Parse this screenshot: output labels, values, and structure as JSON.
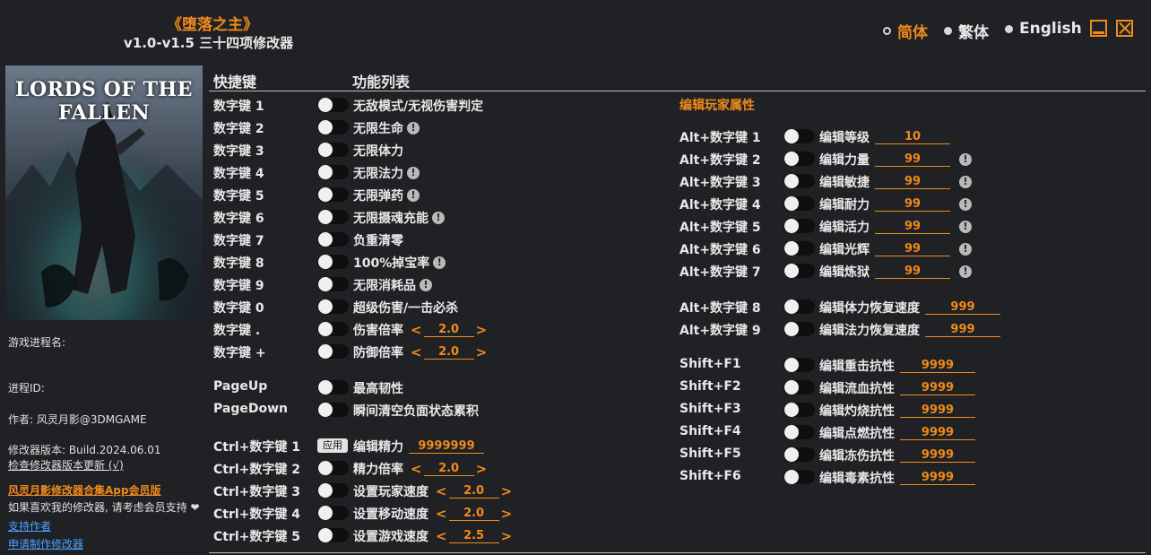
{
  "header": {
    "game_title": "《堕落之主》",
    "version_title": "v1.0-v1.5 三十四项修改器"
  },
  "languages": [
    {
      "label": "简体",
      "active": true
    },
    {
      "label": "繁体",
      "active": false
    },
    {
      "label": "English",
      "active": false
    }
  ],
  "cover": {
    "logo_text": "LORDS OF THE FALLEN"
  },
  "sidebar": {
    "process_name": "游戏进程名:",
    "process_id": "进程ID:",
    "author": "作者: 风灵月影@3DMGAME",
    "build": "修改器版本: Build.2024.06.01",
    "check_update": "检查修改器版本更新 (√)",
    "app_link": "风灵月影修改器合集App会员版",
    "support_text": "如果喜欢我的修改器, 请考虑会员支持 ❤",
    "support_author": "支持作者",
    "request_trainer": "申请制作修改器"
  },
  "columns": {
    "hotkey": "快捷键",
    "features": "功能列表"
  },
  "left_rows": [
    {
      "key": "数字键 1",
      "label": "无敌模式/无视伤害判定",
      "warn": false
    },
    {
      "key": "数字键 2",
      "label": "无限生命",
      "warn": true
    },
    {
      "key": "数字键 3",
      "label": "无限体力",
      "warn": false
    },
    {
      "key": "数字键 4",
      "label": "无限法力",
      "warn": true
    },
    {
      "key": "数字键 5",
      "label": "无限弹药",
      "warn": true
    },
    {
      "key": "数字键 6",
      "label": "无限摄魂充能",
      "warn": true
    },
    {
      "key": "数字键 7",
      "label": "负重清零",
      "warn": false
    },
    {
      "key": "数字键 8",
      "label": "100%掉宝率",
      "warn": true
    },
    {
      "key": "数字键 9",
      "label": "无限消耗品",
      "warn": true
    },
    {
      "key": "数字键 0",
      "label": "超级伤害/一击必杀",
      "warn": false
    },
    {
      "key": "数字键 .",
      "label": "伤害倍率",
      "stepper": "2.0"
    },
    {
      "key": "数字键 +",
      "label": "防御倍率",
      "stepper": "2.0"
    },
    {
      "key": "PageUp",
      "label": "最高韧性"
    },
    {
      "key": "PageDown",
      "label": "瞬间清空负面状态累积"
    },
    {
      "key": "Ctrl+数字键 1",
      "label": "编辑精力",
      "apply": "应用",
      "field": "9999999"
    },
    {
      "key": "Ctrl+数字键 2",
      "label": "精力倍率",
      "stepper": "2.0"
    },
    {
      "key": "Ctrl+数字键 3",
      "label": "设置玩家速度",
      "stepper": "2.0"
    },
    {
      "key": "Ctrl+数字键 4",
      "label": "设置移动速度",
      "stepper": "2.0"
    },
    {
      "key": "Ctrl+数字键 5",
      "label": "设置游戏速度",
      "stepper": "2.5"
    }
  ],
  "right_section_title": "编辑玩家属性",
  "right_rows": [
    {
      "key": "Alt+数字键 1",
      "label": "编辑等级",
      "field": "10",
      "warn": false
    },
    {
      "key": "Alt+数字键 2",
      "label": "编辑力量",
      "field": "99",
      "warn": true
    },
    {
      "key": "Alt+数字键 3",
      "label": "编辑敏捷",
      "field": "99",
      "warn": true
    },
    {
      "key": "Alt+数字键 4",
      "label": "编辑耐力",
      "field": "99",
      "warn": true
    },
    {
      "key": "Alt+数字键 5",
      "label": "编辑活力",
      "field": "99",
      "warn": true
    },
    {
      "key": "Alt+数字键 6",
      "label": "编辑光辉",
      "field": "99",
      "warn": true
    },
    {
      "key": "Alt+数字键 7",
      "label": "编辑炼狱",
      "field": "99",
      "warn": true
    },
    {
      "key": "Alt+数字键 8",
      "label": "编辑体力恢复速度",
      "field": "999"
    },
    {
      "key": "Alt+数字键 9",
      "label": "编辑法力恢复速度",
      "field": "999"
    },
    {
      "key": "Shift+F1",
      "label": "编辑重击抗性",
      "field": "9999"
    },
    {
      "key": "Shift+F2",
      "label": "编辑流血抗性",
      "field": "9999"
    },
    {
      "key": "Shift+F3",
      "label": "编辑灼烧抗性",
      "field": "9999"
    },
    {
      "key": "Shift+F4",
      "label": "编辑点燃抗性",
      "field": "9999"
    },
    {
      "key": "Shift+F5",
      "label": "编辑冻伤抗性",
      "field": "9999"
    },
    {
      "key": "Shift+F6",
      "label": "编辑毒素抗性",
      "field": "9999"
    }
  ]
}
